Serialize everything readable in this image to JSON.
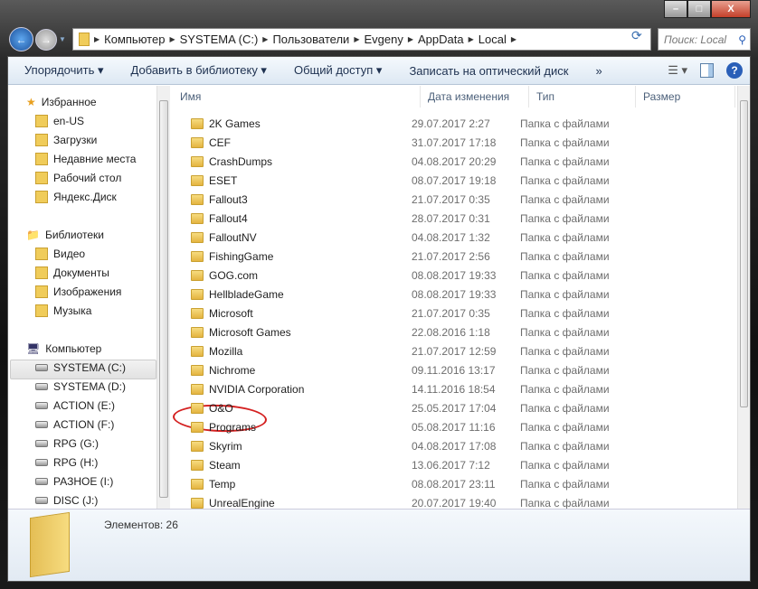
{
  "window": {
    "min": "–",
    "max": "□",
    "close": "X"
  },
  "address": {
    "crumbs": [
      "Компьютер",
      "SYSTEMA (C:)",
      "Пользователи",
      "Evgeny",
      "AppData",
      "Local"
    ],
    "search_placeholder": "Поиск: Local"
  },
  "toolbar": {
    "organize": "Упорядочить ▾",
    "add_library": "Добавить в библиотеку ▾",
    "share": "Общий доступ ▾",
    "burn": "Записать на оптический диск",
    "more": "»",
    "help": "?"
  },
  "nav": {
    "favorites": {
      "label": "Избранное",
      "items": [
        "en-US",
        "Загрузки",
        "Недавние места",
        "Рабочий стол",
        "Яндекс.Диск"
      ]
    },
    "libraries": {
      "label": "Библиотеки",
      "items": [
        "Видео",
        "Документы",
        "Изображения",
        "Музыка"
      ]
    },
    "computer": {
      "label": "Компьютер",
      "items": [
        "SYSTEMA (C:)",
        "SYSTEMA (D:)",
        "ACTION (E:)",
        "ACTION (F:)",
        "RPG (G:)",
        "RPG (H:)",
        "РАЗНОЕ (I:)",
        "DISC (J:)"
      ]
    }
  },
  "columns": {
    "name": "Имя",
    "date": "Дата изменения",
    "type": "Тип",
    "size": "Размер"
  },
  "files": [
    {
      "name": "2K Games",
      "date": "29.07.2017 2:27",
      "type": "Папка с файлами"
    },
    {
      "name": "CEF",
      "date": "31.07.2017 17:18",
      "type": "Папка с файлами"
    },
    {
      "name": "CrashDumps",
      "date": "04.08.2017 20:29",
      "type": "Папка с файлами"
    },
    {
      "name": "ESET",
      "date": "08.07.2017 19:18",
      "type": "Папка с файлами"
    },
    {
      "name": "Fallout3",
      "date": "21.07.2017 0:35",
      "type": "Папка с файлами"
    },
    {
      "name": "Fallout4",
      "date": "28.07.2017 0:31",
      "type": "Папка с файлами"
    },
    {
      "name": "FalloutNV",
      "date": "04.08.2017 1:32",
      "type": "Папка с файлами"
    },
    {
      "name": "FishingGame",
      "date": "21.07.2017 2:56",
      "type": "Папка с файлами"
    },
    {
      "name": "GOG.com",
      "date": "08.08.2017 19:33",
      "type": "Папка с файлами"
    },
    {
      "name": "HellbladeGame",
      "date": "08.08.2017 19:33",
      "type": "Папка с файлами"
    },
    {
      "name": "Microsoft",
      "date": "21.07.2017 0:35",
      "type": "Папка с файлами"
    },
    {
      "name": "Microsoft Games",
      "date": "22.08.2016 1:18",
      "type": "Папка с файлами"
    },
    {
      "name": "Mozilla",
      "date": "21.07.2017 12:59",
      "type": "Папка с файлами"
    },
    {
      "name": "Nichrome",
      "date": "09.11.2016 13:17",
      "type": "Папка с файлами"
    },
    {
      "name": "NVIDIA Corporation",
      "date": "14.11.2016 18:54",
      "type": "Папка с файлами"
    },
    {
      "name": "O&O",
      "date": "25.05.2017 17:04",
      "type": "Папка с файлами"
    },
    {
      "name": "Programs",
      "date": "05.08.2017 11:16",
      "type": "Папка с файлами"
    },
    {
      "name": "Skyrim",
      "date": "04.08.2017 17:08",
      "type": "Папка с файлами"
    },
    {
      "name": "Steam",
      "date": "13.06.2017 7:12",
      "type": "Папка с файлами"
    },
    {
      "name": "Temp",
      "date": "08.08.2017 23:11",
      "type": "Папка с файлами"
    },
    {
      "name": "UnrealEngine",
      "date": "20.07.2017 19:40",
      "type": "Папка с файлами"
    }
  ],
  "status": {
    "count": "Элементов: 26"
  }
}
